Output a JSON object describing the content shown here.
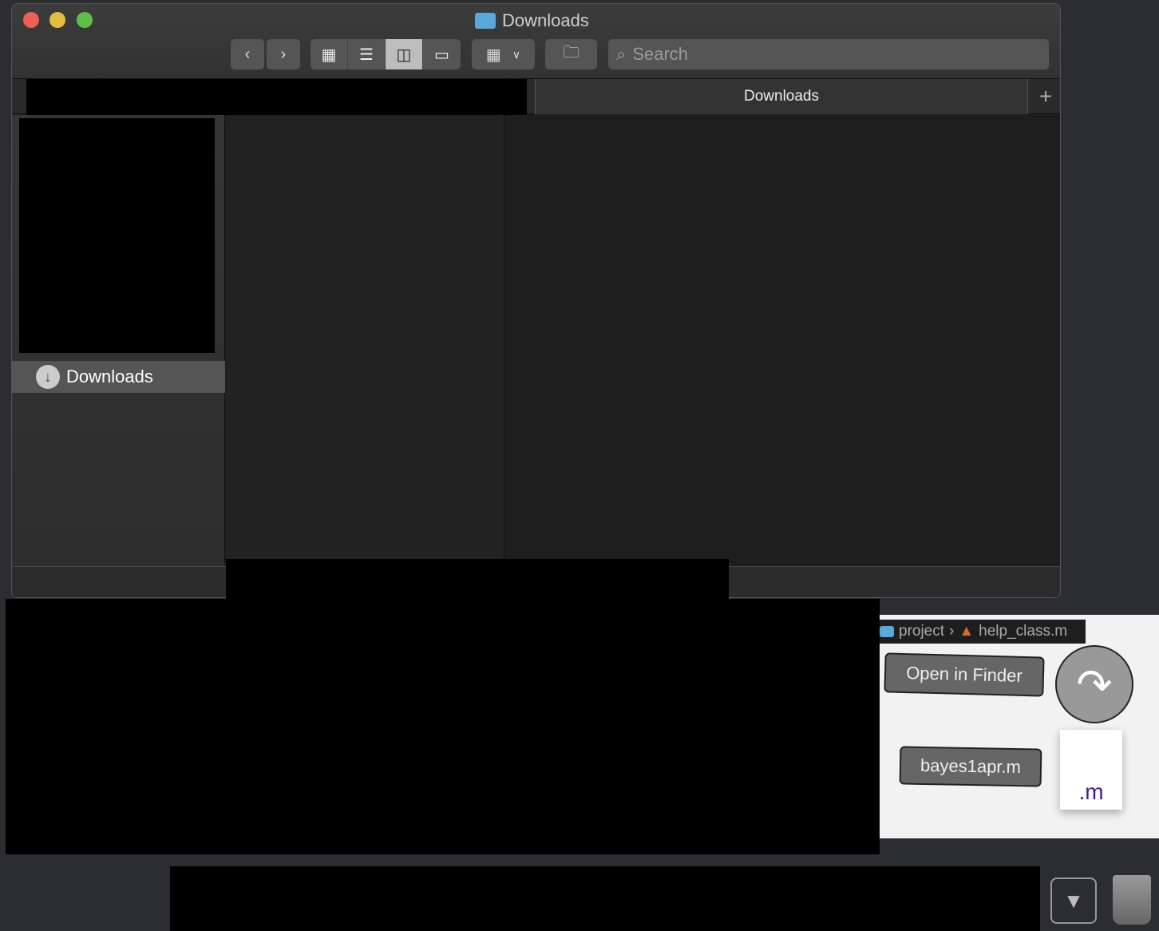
{
  "window": {
    "title": "Downloads",
    "tab_label": "Downloads",
    "new_tab_icon": "plus-icon"
  },
  "toolbar": {
    "back_icon": "chevron-left-icon",
    "forward_icon": "chevron-right-icon",
    "views": [
      "icon-view",
      "list-view",
      "column-view",
      "gallery-view"
    ],
    "selected_view": "column-view",
    "group_icon": "group-by-icon",
    "new_folder_icon": "new-folder-icon",
    "search_placeholder": "Search"
  },
  "sidebar": {
    "selected_item": "Downloads"
  },
  "drag_overlay": {
    "breadcrumb": [
      "project",
      "help_class.m"
    ],
    "open_in_finder": "Open in Finder",
    "file_name": "bayes1apr.m",
    "file_ext": ".m"
  },
  "colors": {
    "close": "#ee5f57",
    "minimize": "#e2bd3f",
    "zoom": "#5fc046",
    "folder": "#5aa7db"
  }
}
